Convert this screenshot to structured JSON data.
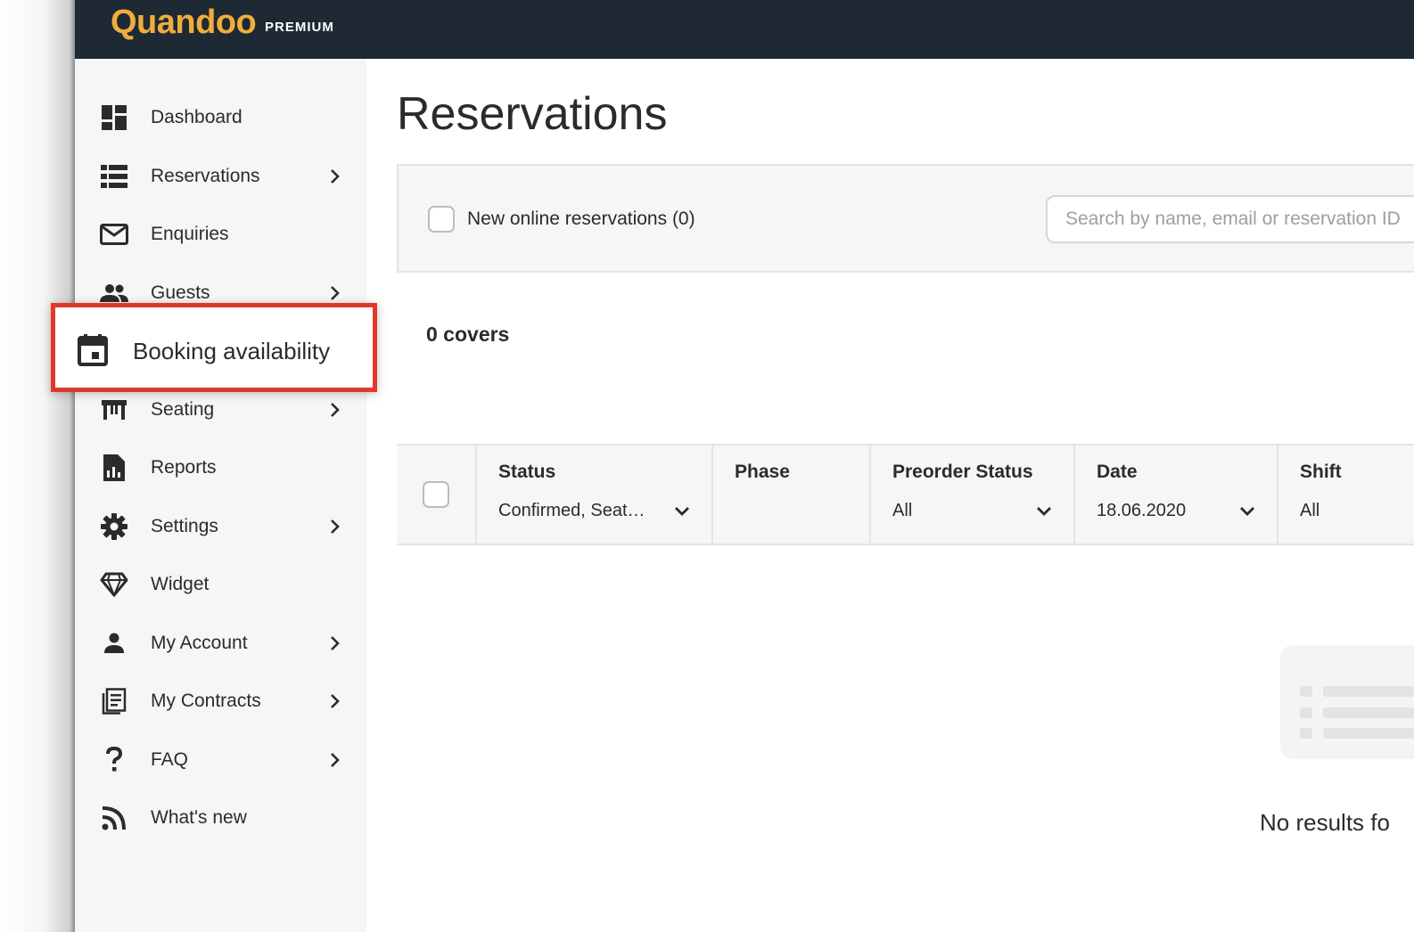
{
  "brand": {
    "logo": "Quandoo",
    "tier": "PREMIUM",
    "logo_color": "#f0ad3b"
  },
  "sidebar": {
    "items": [
      {
        "label": "Dashboard",
        "icon": "dashboard-icon",
        "has_submenu": false
      },
      {
        "label": "Reservations",
        "icon": "list-icon",
        "has_submenu": true
      },
      {
        "label": "Enquiries",
        "icon": "mail-icon",
        "has_submenu": false
      },
      {
        "label": "Guests",
        "icon": "people-icon",
        "has_submenu": true
      },
      {
        "label": "Booking availability",
        "icon": "calendar-icon",
        "has_submenu": false,
        "highlighted": true
      },
      {
        "label": "Seating",
        "icon": "table-icon",
        "has_submenu": true
      },
      {
        "label": "Reports",
        "icon": "report-icon",
        "has_submenu": false
      },
      {
        "label": "Settings",
        "icon": "gear-icon",
        "has_submenu": true
      },
      {
        "label": "Widget",
        "icon": "diamond-icon",
        "has_submenu": false
      },
      {
        "label": "My Account",
        "icon": "person-icon",
        "has_submenu": true
      },
      {
        "label": "My Contracts",
        "icon": "document-icon",
        "has_submenu": true
      },
      {
        "label": "FAQ",
        "icon": "question-icon",
        "has_submenu": true
      },
      {
        "label": "What's new",
        "icon": "rss-icon",
        "has_submenu": false
      }
    ]
  },
  "main": {
    "title": "Reservations",
    "filters": {
      "new_online_label": "New online reservations (0)",
      "search_placeholder": "Search by name, email or reservation ID"
    },
    "covers": "0 covers",
    "table": {
      "columns": [
        {
          "title": "Status",
          "value": "Confirmed, Seat…",
          "dropdown": true
        },
        {
          "title": "Phase",
          "value": "",
          "dropdown": false
        },
        {
          "title": "Preorder Status",
          "value": "All",
          "dropdown": true
        },
        {
          "title": "Date",
          "value": "18.06.2020",
          "dropdown": true
        },
        {
          "title": "Shift",
          "value": "All",
          "dropdown": false
        }
      ]
    },
    "empty_state": "No results fo"
  },
  "colors": {
    "topbar": "#1f2933",
    "highlight_border": "#e0392b",
    "sidebar_bg": "#f5f6f6"
  }
}
